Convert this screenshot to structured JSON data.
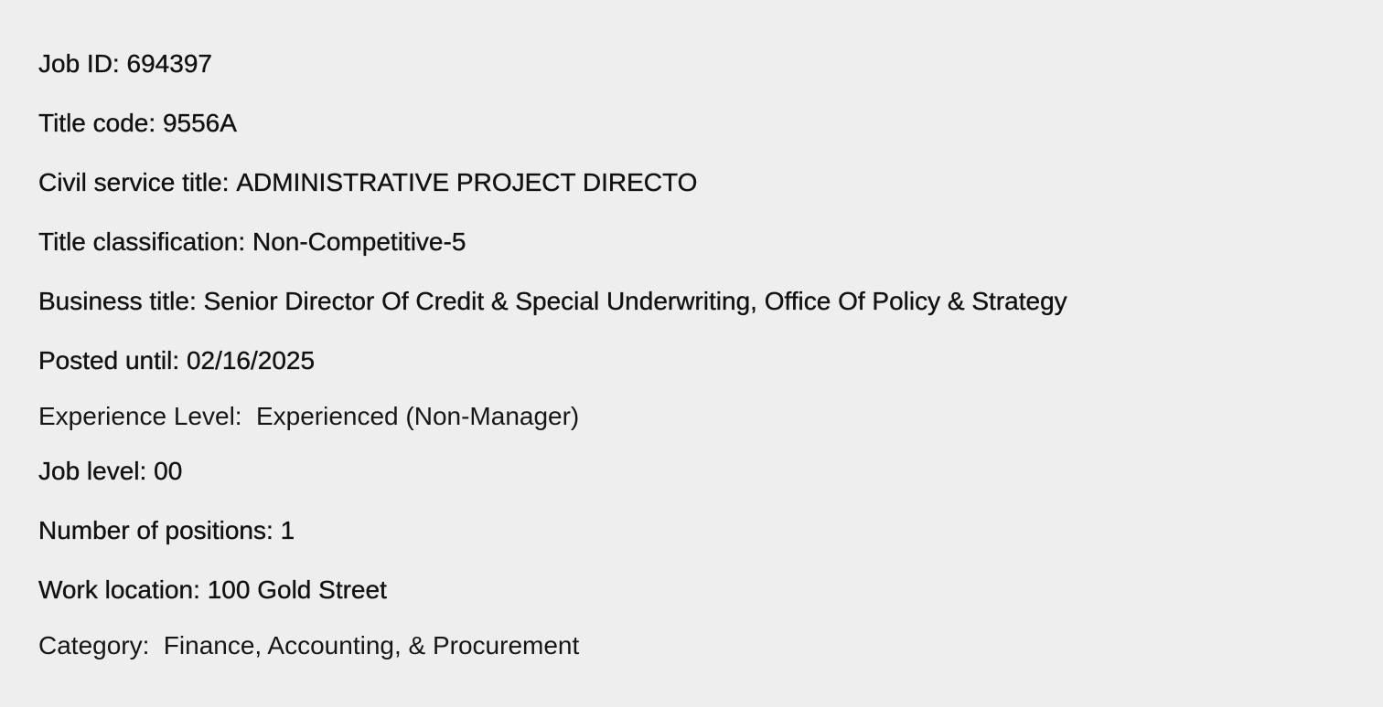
{
  "job_details": {
    "job_id": {
      "label": "Job ID:",
      "value": "694397"
    },
    "title_code": {
      "label": "Title code:",
      "value": "9556A"
    },
    "civil_service_title": {
      "label": "Civil service title:",
      "value": "ADMINISTRATIVE PROJECT DIRECTO"
    },
    "title_classification": {
      "label": "Title classification:",
      "value": "Non-Competitive-5"
    },
    "business_title": {
      "label": "Business title:",
      "value": "Senior Director Of Credit & Special Underwriting, Office Of Policy & Strategy"
    },
    "posted_until": {
      "label": "Posted until:",
      "value": "02/16/2025"
    },
    "experience_level": {
      "label": "Experience Level:",
      "value": "Experienced (Non-Manager)"
    },
    "job_level": {
      "label": "Job level:",
      "value": "00"
    },
    "number_of_positions": {
      "label": "Number of positions:",
      "value": "1"
    },
    "work_location": {
      "label": "Work location:",
      "value": "100 Gold Street"
    },
    "category": {
      "label": "Category:",
      "value": "Finance, Accounting, & Procurement"
    }
  }
}
